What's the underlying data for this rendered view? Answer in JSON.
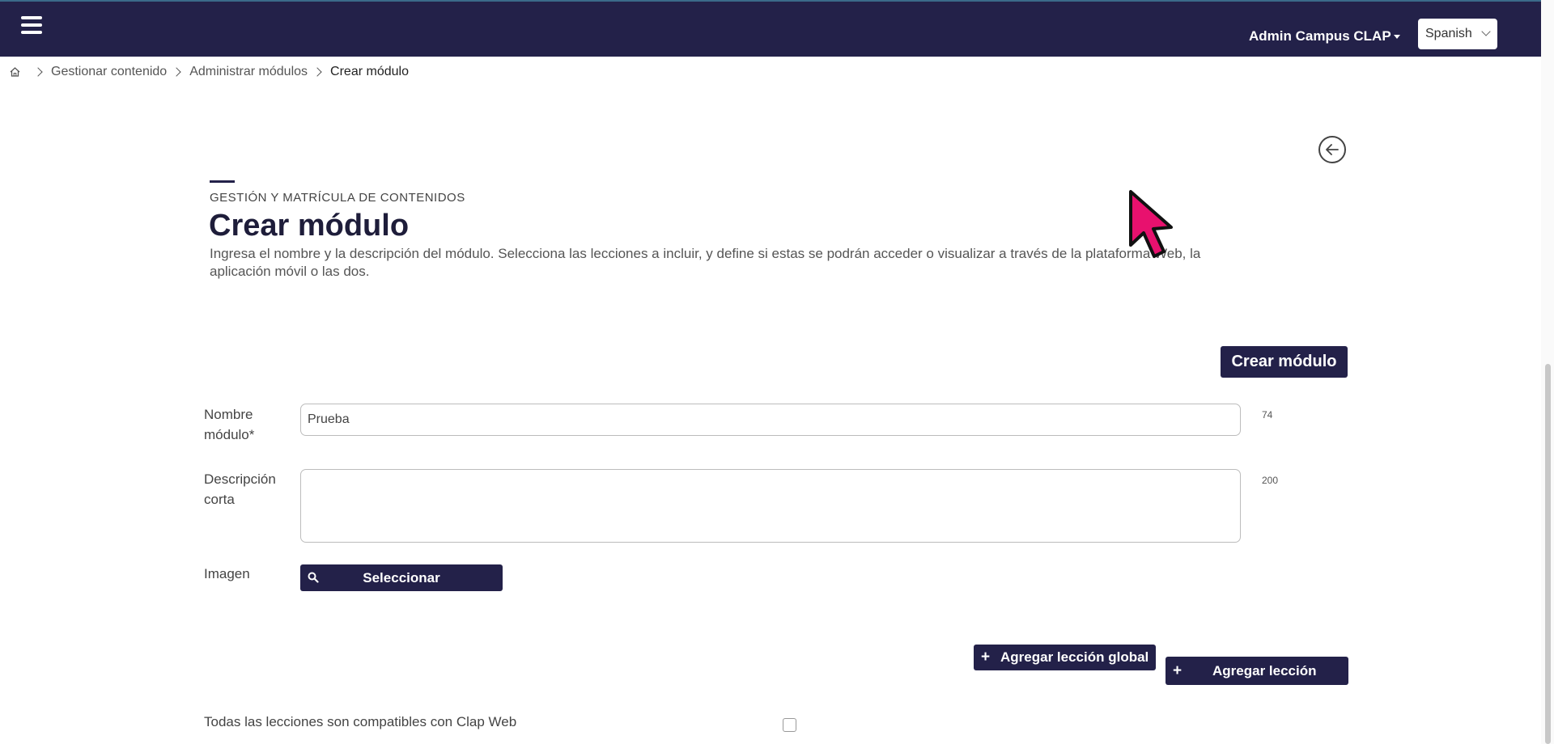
{
  "header": {
    "user_name": "Admin Campus CLAP",
    "language": "Spanish"
  },
  "breadcrumb": {
    "items": [
      "Gestionar contenido",
      "Administrar módulos"
    ],
    "current": "Crear módulo"
  },
  "page": {
    "eyebrow": "GESTIÓN Y MATRÍCULA DE CONTENIDOS",
    "title": "Crear módulo",
    "description": "Ingresa el nombre y la descripción del módulo. Selecciona las lecciones a incluir, y define si estas se podrán acceder o visualizar a través de la plataforma Web, la aplicación móvil o las dos."
  },
  "actions": {
    "create_label": "Crear módulo",
    "add_global_label": "Agregar lección global",
    "add_lesson_label": "Agregar lección"
  },
  "form": {
    "name_label": "Nombre módulo*",
    "name_value": "Prueba",
    "name_counter": "74",
    "description_label": "Descripción corta",
    "description_value": "",
    "description_counter": "200",
    "image_label": "Imagen",
    "select_label": "Seleccionar",
    "compat_label": "Todas las lecciones son compatibles con Clap Web"
  },
  "colors": {
    "navy": "#232149",
    "cursor": "#e8116e"
  }
}
